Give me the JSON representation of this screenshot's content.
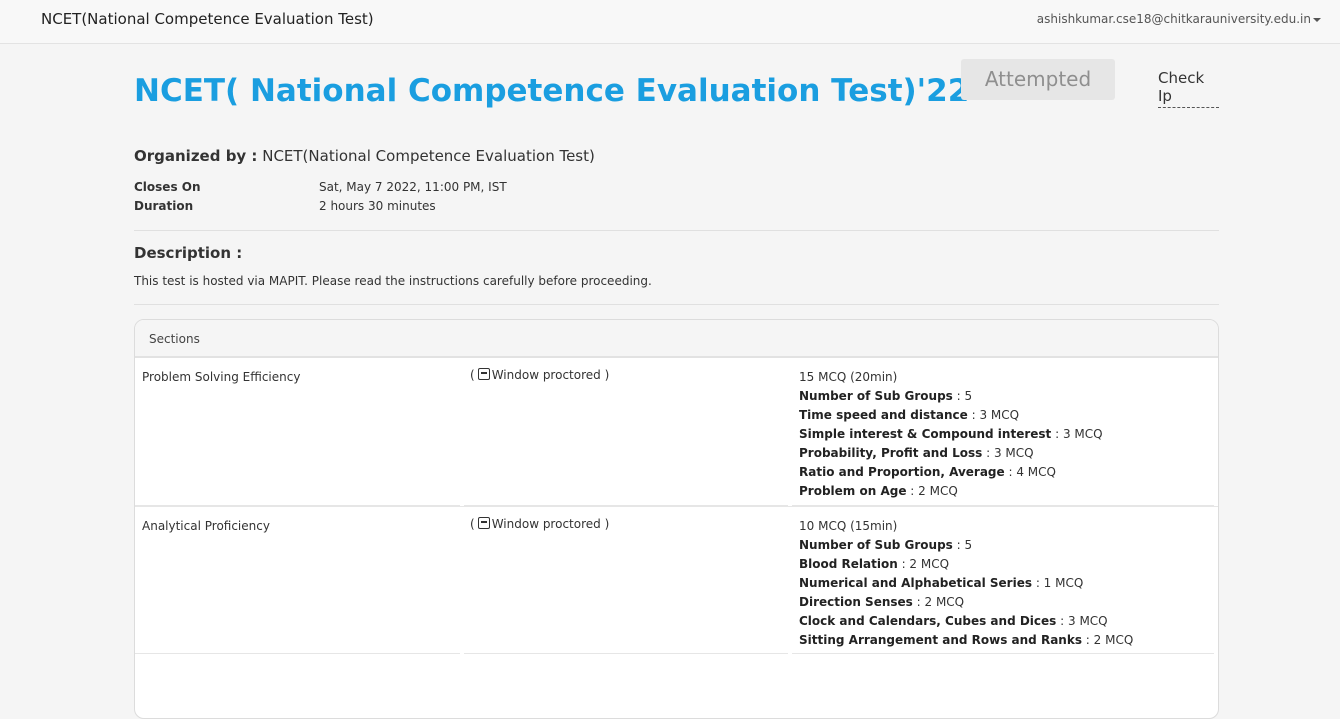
{
  "topbar": {
    "brand": "NCET(National Competence Evaluation Test)",
    "user_email": "ashishkumar.cse18@chitkarauniversity.edu.in"
  },
  "test": {
    "title": "NCET( National Competence Evaluation Test)'22",
    "status_button": "Attempted",
    "check_ip_link": "Check Ip",
    "organized_label": "Organized by :",
    "organizer": "NCET(National Competence Evaluation Test)",
    "closes_label": "Closes On",
    "closes_value": "Sat, May 7 2022, 11:00 PM, IST",
    "duration_label": "Duration",
    "duration_value": "2 hours 30 minutes",
    "description_heading": "Description :",
    "description_text": "This test is hosted via MAPIT. Please read the instructions carefully before proceeding."
  },
  "sections": {
    "header": "Sections",
    "rows": [
      {
        "name": "Problem Solving Efficiency",
        "proctor_prefix": "(",
        "proctor_label": "Window proctored )",
        "icon": "window-icon",
        "summary": "15 MCQ (20min)",
        "subgroups_label": "Number of Sub Groups",
        "subgroups_value": ": 5",
        "items": [
          {
            "label": "Time speed and distance",
            "value": ": 3 MCQ"
          },
          {
            "label": "Simple interest & Compound interest",
            "value": ": 3 MCQ"
          },
          {
            "label": "Probability, Profit and Loss",
            "value": ": 3 MCQ"
          },
          {
            "label": "Ratio and Proportion, Average",
            "value": ": 4 MCQ"
          },
          {
            "label": "Problem on Age",
            "value": ": 2 MCQ"
          }
        ]
      },
      {
        "name": "Analytical Proficiency",
        "proctor_prefix": "(",
        "proctor_label": "Window proctored )",
        "icon": "window-icon",
        "summary": "10 MCQ (15min)",
        "subgroups_label": "Number of Sub Groups",
        "subgroups_value": ": 5",
        "items": [
          {
            "label": "Blood Relation",
            "value": ": 2 MCQ"
          },
          {
            "label": "Numerical and Alphabetical Series",
            "value": ": 1 MCQ"
          },
          {
            "label": "Direction Senses",
            "value": ": 2 MCQ"
          },
          {
            "label": "Clock and Calendars, Cubes and Dices",
            "value": ": 3 MCQ"
          },
          {
            "label": "Sitting Arrangement and Rows and Ranks",
            "value": ": 2 MCQ"
          }
        ]
      }
    ]
  },
  "colors": {
    "title": "#1a9ee0",
    "attempted_bg": "#e6e6e6",
    "attempted_text": "#8f8f8f"
  }
}
